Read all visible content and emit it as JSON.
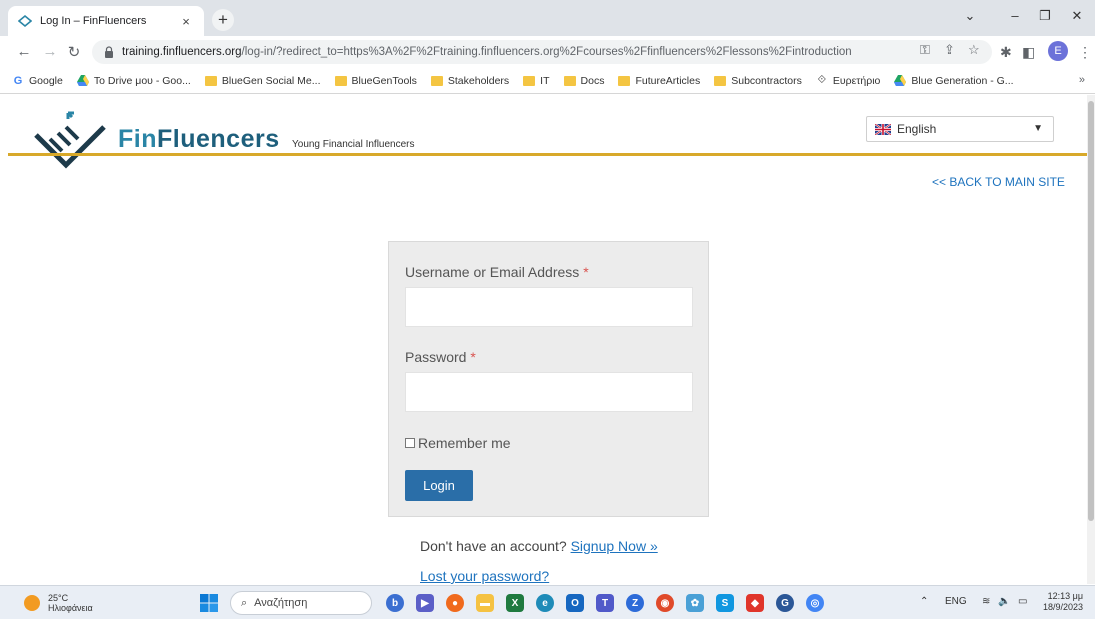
{
  "browser": {
    "tab_title": "Log In – FinFluencers",
    "tab_close": "×",
    "new_tab": "+",
    "url_host": "training.finfluencers.org",
    "url_path": "/log-in/?redirect_to=https%3A%2F%2Ftraining.finfluencers.org%2Fcourses%2Ffinfluencers%2Flessons%2Fintroduction",
    "profile_initial": "E",
    "bookmarks": [
      {
        "label": "Google",
        "icon": "google-icon"
      },
      {
        "label": "To Drive μου - Goo...",
        "icon": "drive-icon"
      },
      {
        "label": "BlueGen Social Me...",
        "icon": "folder-icon"
      },
      {
        "label": "BlueGenTools",
        "icon": "folder-icon"
      },
      {
        "label": "Stakeholders",
        "icon": "folder-icon"
      },
      {
        "label": "IT",
        "icon": "folder-icon"
      },
      {
        "label": "Docs",
        "icon": "folder-icon"
      },
      {
        "label": "FutureArticles",
        "icon": "folder-icon"
      },
      {
        "label": "Subcontractors",
        "icon": "folder-icon"
      },
      {
        "label": "Ευρετήριο",
        "icon": "index-icon"
      },
      {
        "label": "Blue Generation - G...",
        "icon": "drive-icon"
      }
    ],
    "bookmarks_more": "»"
  },
  "site": {
    "brand_fin": "Fin",
    "brand_rest": "Fluencers",
    "tagline": "Young Financial Influencers",
    "language": "English",
    "back_link": "<< BACK TO MAIN SITE"
  },
  "login": {
    "username_label": "Username or Email Address",
    "password_label": "Password",
    "required_mark": "*",
    "username_value": "",
    "password_value": "",
    "remember_label": "Remember me",
    "remember_checked": false,
    "submit_label": "Login",
    "signup_prompt": "Don't have an account?",
    "signup_link": "Signup Now »",
    "lost_password": "Lost your password?"
  },
  "taskbar": {
    "temperature": "25°C",
    "weather": "Ηλιοφάνεια",
    "search_placeholder": "Αναζήτηση",
    "lang": "ENG",
    "time": "12:13 μμ",
    "date": "18/9/2023"
  },
  "colors": {
    "brand_blue": "#1e5f7c",
    "gold_line": "#d8a92a",
    "button_blue": "#2a6ea8",
    "link_blue": "#1e73be",
    "required_red": "#d9534f"
  }
}
